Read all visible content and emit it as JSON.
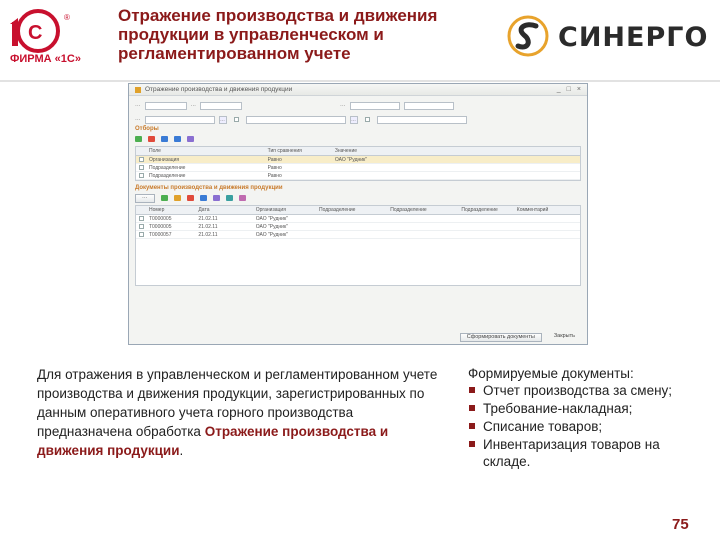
{
  "header": {
    "logo_1c_text": "ФИРМА «1С»",
    "title": "Отражение производства и движения продукции в управленческом и регламентированном учете",
    "brand_name": "СИНЕРГО"
  },
  "window": {
    "title": "Отражение производства и движения продукции",
    "section_filters": "Отборы",
    "filter_headers": [
      "Поле",
      "Тип сравнения",
      "Значение"
    ],
    "filter_rows": [
      [
        "Организация",
        "Равно",
        "ОАО \"Рудник\""
      ],
      [
        "Подразделение",
        "Равно",
        ""
      ],
      [
        "Подразделение",
        "Равно",
        ""
      ]
    ],
    "section_docs": "Документы производства и движения продукции",
    "doc_headers": [
      "Номер",
      "Дата",
      "Организация",
      "Подразделение",
      "Подразделение",
      "Подразделение",
      "Комментарий"
    ],
    "doc_rows": [
      [
        "Т0000005",
        "21.02.11",
        "ОАО \"Рудник\"",
        "",
        "",
        "",
        ""
      ],
      [
        "Т0000005",
        "21.02.11",
        "ОАО \"Рудник\"",
        "",
        "",
        "",
        ""
      ],
      [
        "Т0000057",
        "21.02.11",
        "ОАО \"Рудник\"",
        "",
        "",
        "",
        ""
      ]
    ],
    "btn_form_docs": "Сформировать документы",
    "btn_close": "Закрыть"
  },
  "body": {
    "left_text": "Для отражения в управленческом и регламентированном учете производства и движения продукции, зарегистрированных по данным оперативного учета горного производства предназначена обработка",
    "left_highlight": "Отражение производства и движения продукции",
    "left_end": ".",
    "right_heading": "Формируемые документы:",
    "right_items": [
      "Отчет производства за смену;",
      "Требование-накладная;",
      "Списание товаров;",
      "Инвентаризация товаров на складе."
    ]
  },
  "page_number": "75",
  "colors": {
    "accent": "#8b1a1a",
    "logo_red": "#c8102e",
    "brand_orange": "#e8a32c"
  }
}
